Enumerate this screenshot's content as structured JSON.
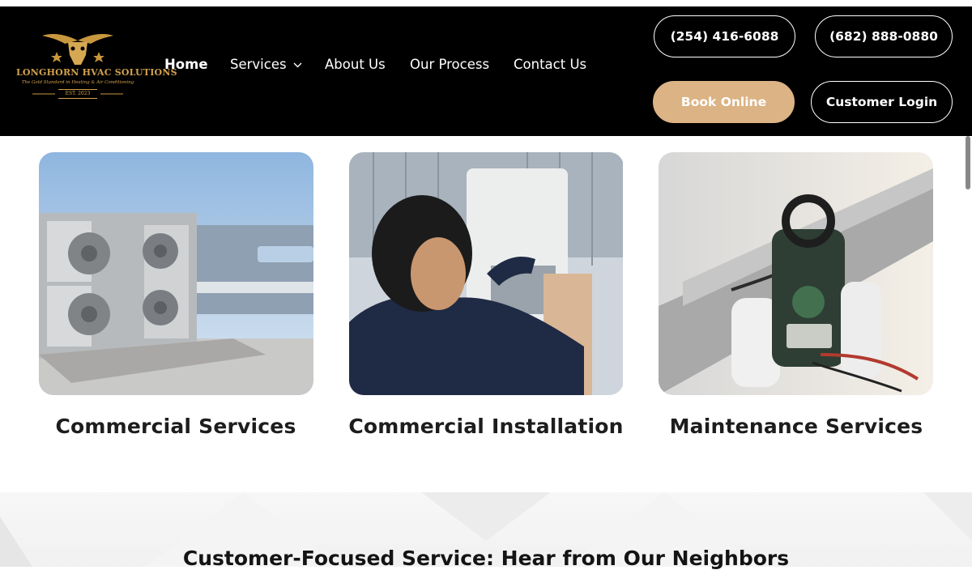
{
  "logo": {
    "name": "LONGHORN HVAC SOLUTIONS",
    "tagline": "The Gold Standard in Heating & Air Conditioning",
    "est": "EST. 2023"
  },
  "nav": {
    "home": "Home",
    "services": "Services",
    "about": "About Us",
    "process": "Our Process",
    "contact": "Contact Us"
  },
  "header_buttons": {
    "phone1": "(254) 416-6088",
    "phone2": "(682) 888-0880",
    "book": "Book Online",
    "login": "Customer Login"
  },
  "cards": [
    {
      "title": "Commercial Services"
    },
    {
      "title": "Commercial Installation"
    },
    {
      "title": "Maintenance Services"
    }
  ],
  "testimonials": {
    "title": "Customer-Focused Service: Hear from Our Neighbors"
  },
  "colors": {
    "header_bg": "#000000",
    "accent_gold": "#dcb384",
    "logo_gold": "#d3a24c",
    "heading_text": "#1d1d1d"
  },
  "icons": [
    "longhorn-logo",
    "chevron-down-icon"
  ]
}
